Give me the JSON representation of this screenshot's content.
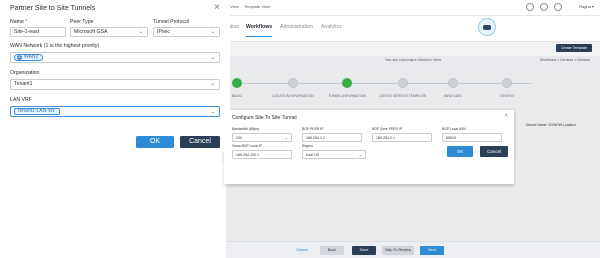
{
  "dialog": {
    "title": "Partner Site to Site Tunnels",
    "close_icon": "close-icon",
    "fields": {
      "name": {
        "label": "Name",
        "required_mark": "*",
        "value": "Site-1-east"
      },
      "peer_type": {
        "label": "Peer Type",
        "value": "Microsoft GSA"
      },
      "tunnel_protocol": {
        "label": "Tunnel Protocol",
        "value": "IPsec"
      },
      "wan_network": {
        "label": "WAN Network (1 is the highest priority)",
        "chip_index": "1",
        "chip_label": "WAN2"
      },
      "organization": {
        "label": "Organization",
        "value": "Tenant1"
      },
      "lan_vrf": {
        "label": "LAN VRF",
        "value": "Tenant1-LAN-VR"
      }
    },
    "ok_label": "OK",
    "cancel_label": "Cancel"
  },
  "background": {
    "topbar": {
      "link1": "View",
      "link2": "Template View",
      "user": "Raghu ▾"
    },
    "nav": {
      "tab1": "ation",
      "tab2": "Workflows",
      "tab3": "Administration",
      "tab4": "Analytics"
    },
    "new_template_label": "Create Template",
    "info_text": "You are currently in Director View",
    "breadcrumb": "Workflows > Devices > Devices",
    "steps": [
      "BASIC",
      "LOCATION INFORMATION",
      "TUNNEL INFORMATION",
      "DEVICE SERVICE TEMPLATE",
      "BIND DATA",
      "REVIEW"
    ],
    "right_hint": "Device Name: SGWHW-Location",
    "bottom": {
      "cancel": "Cancel",
      "back": "Back",
      "save": "Save",
      "skip": "Skip To Review",
      "next": "Next"
    }
  },
  "inner_modal": {
    "title": "Configure Site To Site Tunnel",
    "fields": {
      "bandwidth": {
        "label": "Bandwidth (KBps)",
        "value": "200"
      },
      "bgp_peer_ip": {
        "label": "BGP PEER IP",
        "value": "169.254.1.2"
      },
      "bgp_zone_peer_ip": {
        "label": "BGP Zone PEER IP",
        "value": "169.254.2.1"
      },
      "bgp_local_asn": {
        "label": "BGP Local ASN",
        "value": "65515"
      },
      "versa_bgp_local_ip": {
        "label": "Versa BGP Local IP",
        "value": "169.254.100.1"
      },
      "region": {
        "label": "Region",
        "value": "East US"
      }
    },
    "ok_label": "OK",
    "cancel_label": "Cancel"
  }
}
